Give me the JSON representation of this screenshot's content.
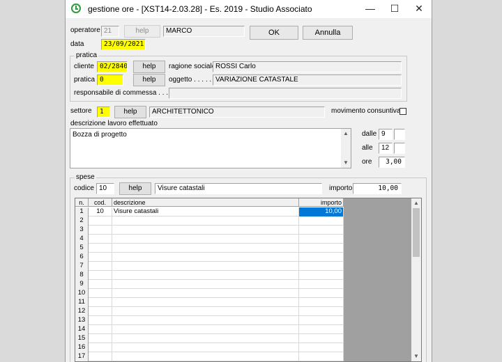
{
  "window": {
    "title": "gestione ore - [XST14-2.03.28] - Es. 2019 - Studio Associato",
    "minimize_glyph": "—",
    "maximize_glyph": "☐",
    "close_glyph": "✕"
  },
  "header": {
    "operatore_label": "operatore",
    "operatore_code": "21",
    "operatore_help": "help",
    "operatore_name": "MARCO",
    "data_label": "data",
    "data_value": "23/09/2021",
    "ok_label": "OK",
    "annulla_label": "Annulla"
  },
  "pratica_group": {
    "title": "pratica",
    "cliente_label": "cliente",
    "cliente_value": "02/2840",
    "cliente_help": "help",
    "ragione_label": "ragione sociale",
    "ragione_value": "ROSSI Carlo",
    "pratica_label": "pratica",
    "pratica_value": "0",
    "pratica_help": "help",
    "oggetto_label": "oggetto . . . . . . . .",
    "oggetto_value": "VARIAZIONE CATASTALE",
    "responsabile_label": "responsabile di commessa . . . . . .",
    "responsabile_value": ""
  },
  "settore": {
    "label": "settore",
    "value": "1",
    "help": "help",
    "name": "ARCHITETTONICO",
    "movimento_label": "movimento consuntivato",
    "movimento_checked": false
  },
  "descrizione": {
    "label": "descrizione lavoro effettuato",
    "value": "Bozza di progetto"
  },
  "orario": {
    "dalle_label": "dalle",
    "dalle_h": "9",
    "dalle_m": "",
    "alle_label": "alle",
    "alle_h": "12",
    "alle_m": "",
    "ore_label": "ore",
    "ore_value": "3,00"
  },
  "spese": {
    "title": "spese",
    "codice_label": "codice",
    "codice_value": "10",
    "help": "help",
    "descrizione_value": "Visure catastali",
    "importo_label": "importo",
    "importo_value": "10,00",
    "columns": [
      "n.",
      "cod.",
      "descrizione",
      "importo"
    ],
    "rows": [
      {
        "n": "1",
        "cod": "10",
        "descrizione": "Visure catastali",
        "importo": "10,00"
      },
      {
        "n": "2",
        "cod": "",
        "descrizione": "",
        "importo": ""
      },
      {
        "n": "3",
        "cod": "",
        "descrizione": "",
        "importo": ""
      },
      {
        "n": "4",
        "cod": "",
        "descrizione": "",
        "importo": ""
      },
      {
        "n": "5",
        "cod": "",
        "descrizione": "",
        "importo": ""
      },
      {
        "n": "6",
        "cod": "",
        "descrizione": "",
        "importo": ""
      },
      {
        "n": "7",
        "cod": "",
        "descrizione": "",
        "importo": ""
      },
      {
        "n": "8",
        "cod": "",
        "descrizione": "",
        "importo": ""
      },
      {
        "n": "9",
        "cod": "",
        "descrizione": "",
        "importo": ""
      },
      {
        "n": "10",
        "cod": "",
        "descrizione": "",
        "importo": ""
      },
      {
        "n": "11",
        "cod": "",
        "descrizione": "",
        "importo": ""
      },
      {
        "n": "12",
        "cod": "",
        "descrizione": "",
        "importo": ""
      },
      {
        "n": "13",
        "cod": "",
        "descrizione": "",
        "importo": ""
      },
      {
        "n": "14",
        "cod": "",
        "descrizione": "",
        "importo": ""
      },
      {
        "n": "15",
        "cod": "",
        "descrizione": "",
        "importo": ""
      },
      {
        "n": "16",
        "cod": "",
        "descrizione": "",
        "importo": ""
      },
      {
        "n": "17",
        "cod": "",
        "descrizione": "",
        "importo": ""
      }
    ]
  },
  "colors": {
    "highlight_yellow": "#ffff00",
    "selection_blue": "#0078d7",
    "window_bg": "#f0f0f0"
  }
}
